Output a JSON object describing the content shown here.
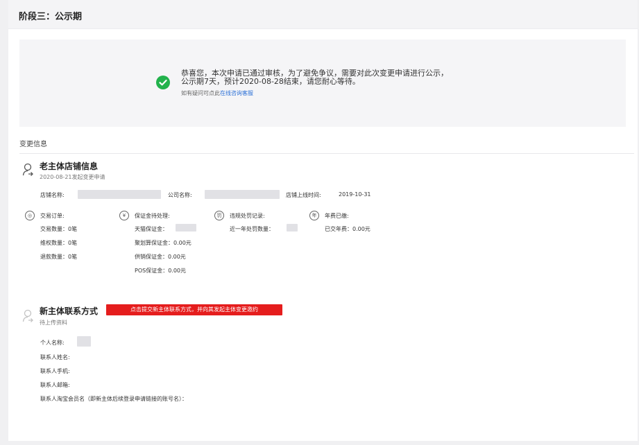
{
  "stage": {
    "title": "阶段三：公示期"
  },
  "notice": {
    "line1": "恭喜您，本次申请已通过审核，为了避免争议，需要对此次变更申请进行公示，",
    "line2": "公示期7天，预计2020-08-28结束，请您耐心等待。",
    "help_prefix": "如有疑问可点此",
    "help_link": "在线咨询客服",
    "status_icon": "check-circle-icon",
    "status_color": "#22b24c"
  },
  "section": {
    "title": "变更信息"
  },
  "old_owner": {
    "icon": "user-arrow-icon",
    "title": "老主体店铺信息",
    "subtitle": "2020-08-21发起变更申请",
    "store_name_label": "店铺名称:",
    "company_name_label": "公司名称:",
    "online_time_label": "店铺上线时间:",
    "online_time_value": "2019-10-31",
    "columns": {
      "orders": {
        "icon": "order-icon",
        "head": "交易订单:",
        "items": [
          "交易数量：0笔",
          "维权数量：0笔",
          "退款数量：0笔"
        ]
      },
      "deposit": {
        "icon": "yen-icon",
        "head": "保证金待处理:",
        "items": [
          "天猫保证金：",
          "聚划算保证金：0.00元",
          "供销保证金：0.00元",
          "POS保证金：0.00元"
        ]
      },
      "violations": {
        "icon": "penalty-icon",
        "head": "违规处罚记录:",
        "items": [
          "近一年处罚数量："
        ]
      },
      "annual_fee": {
        "icon": "fee-icon",
        "head": "年费已缴:",
        "items": [
          "已交年费：0.00元"
        ]
      }
    }
  },
  "new_owner": {
    "icon": "user-arrow-icon",
    "title": "新主体联系方式",
    "button": "点击提交新主体联系方式，并向其发起主体变更邀约",
    "button_color": "#e51d1d",
    "subtitle": "待上传资料",
    "fields": [
      "个人名称:",
      "联系人姓名:",
      "联系人手机:",
      "联系人邮箱:",
      "联系人淘宝会员名（即新主体后续登录申请链接的账号名）："
    ]
  }
}
